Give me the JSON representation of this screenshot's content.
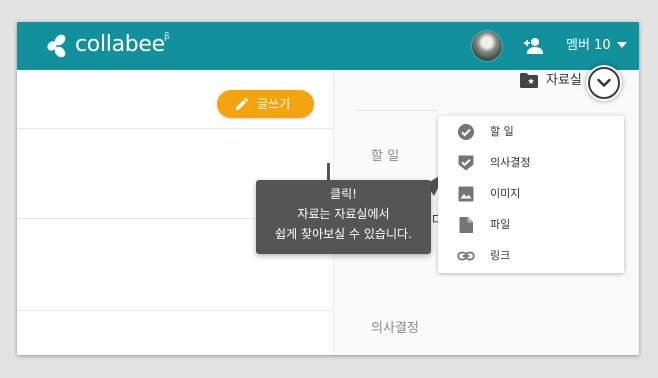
{
  "app": {
    "brand": "collabee",
    "beta_mark": "β"
  },
  "header": {
    "member_label": "멤버 10",
    "icons": [
      "logo-icon",
      "avatar",
      "add-person-icon",
      "caret-down-icon"
    ]
  },
  "toolbar": {
    "write_label": "글쓰기",
    "icon": "pencil-icon"
  },
  "files": {
    "label": "자료실",
    "icon": "folder-star-icon",
    "expand_icon": "chevron-down-icon"
  },
  "sections": {
    "todo": "할 일",
    "decision": "의사결정"
  },
  "tooltip": {
    "line1": "클릭!",
    "line2": "자료는 자료실에서",
    "line3": "쉽게 찾아보실 수 있습니다."
  },
  "dropdown": {
    "items": [
      {
        "label": "할 일",
        "icon": "check-circle-icon"
      },
      {
        "label": "의사결정",
        "icon": "shield-check-icon"
      },
      {
        "label": "이미지",
        "icon": "image-icon"
      },
      {
        "label": "파일",
        "icon": "file-icon"
      },
      {
        "label": "링크",
        "icon": "link-icon"
      }
    ]
  },
  "colors": {
    "topbar": "#12909c",
    "accent_button": "#f4a40f",
    "tooltip_bg": "#555555",
    "icon_gray": "#757575"
  }
}
